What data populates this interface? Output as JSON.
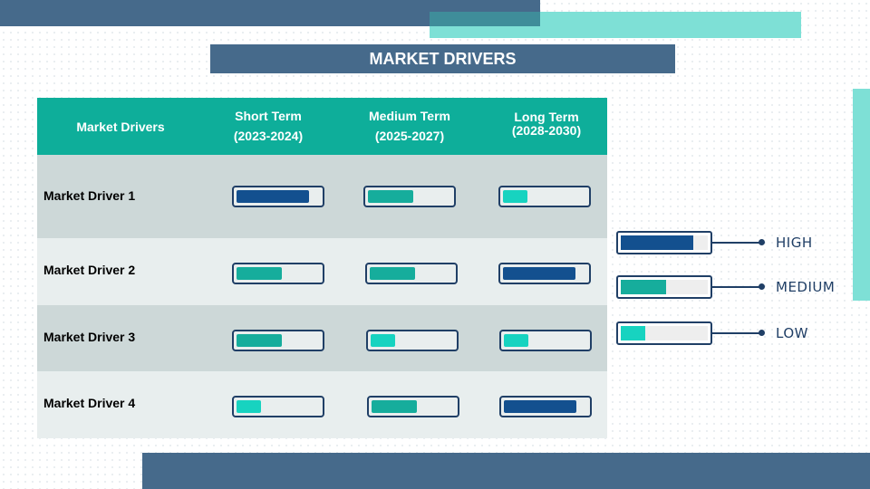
{
  "title": "MARKET DRIVERS",
  "colors": {
    "high": "#13508f",
    "medium": "#16ad9c",
    "low": "#17d3c0",
    "header": "#0eae9a",
    "accent_blue": "#466a8b",
    "accent_teal": "#7ee0d6"
  },
  "table": {
    "header": {
      "main": "Market Drivers",
      "short_term": {
        "label": "Short Term",
        "years": "(2023-2024)"
      },
      "medium_term": {
        "label": "Medium Term",
        "years": "(2025-2027)"
      },
      "long_term": {
        "label": "Long Term",
        "years": "(2028-2030)"
      }
    },
    "rows": [
      {
        "label": "Market Driver 1",
        "short": "high",
        "medium": "medium",
        "long": "low"
      },
      {
        "label": "Market Driver 2",
        "short": "medium",
        "medium": "medium",
        "long": "high"
      },
      {
        "label": "Market Driver 3",
        "short": "medium",
        "medium": "low",
        "long": "low"
      },
      {
        "label": "Market Driver 4",
        "short": "low",
        "medium": "medium",
        "long": "high"
      }
    ]
  },
  "legend": [
    {
      "level": "high",
      "label": "HIGH"
    },
    {
      "level": "medium",
      "label": "MEDIUM"
    },
    {
      "level": "low",
      "label": "LOW"
    }
  ]
}
